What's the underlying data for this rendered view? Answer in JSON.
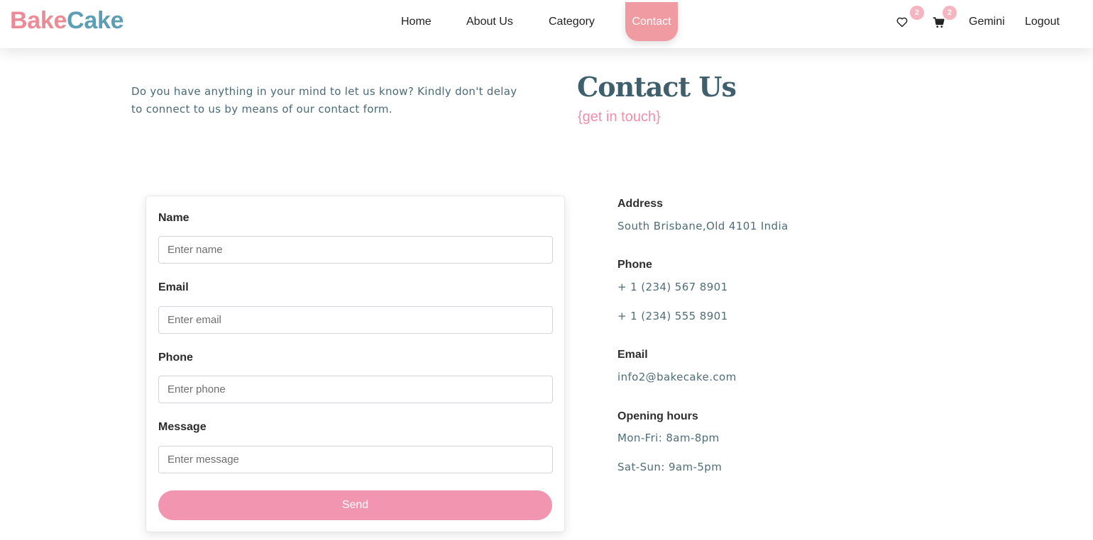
{
  "brand": {
    "part1": "Bake",
    "part2": "Cake"
  },
  "nav": {
    "home": "Home",
    "about": "About Us",
    "category": "Category",
    "contact": "Contact",
    "wishlist_count": "2",
    "cart_count": "2",
    "user": "Gemini",
    "logout": "Logout",
    "icons": [
      "heart-icon",
      "cart-icon"
    ]
  },
  "intro": {
    "text": "Do you have anything in your mind to let us know? Kindly don't delay to connect to us by means of our contact form.",
    "title": "Contact Us",
    "subtitle": "{get in touch}"
  },
  "form": {
    "name_label": "Name",
    "name_placeholder": "Enter name",
    "email_label": "Email",
    "email_placeholder": "Enter email",
    "phone_label": "Phone",
    "phone_placeholder": "Enter phone",
    "message_label": "Message",
    "message_placeholder": "Enter message",
    "send_label": "Send"
  },
  "info": {
    "address_label": "Address",
    "address": "South Brisbane,Old 4101 India",
    "phone_label": "Phone",
    "phone1": "+ 1 (234) 567 8901",
    "phone2": "+ 1 (234) 555 8901",
    "email_label": "Email",
    "email": "info2@bakecake.com",
    "hours_label": "Opening hours",
    "hours1": "Mon-Fri: 8am-8pm",
    "hours2": "Sat-Sun: 9am-5pm"
  },
  "colors": {
    "brand_pink": "#ec8b95",
    "brand_blue": "#5d9eb7",
    "accent_pink": "#f195b1",
    "title_teal": "#3e5f6b"
  }
}
